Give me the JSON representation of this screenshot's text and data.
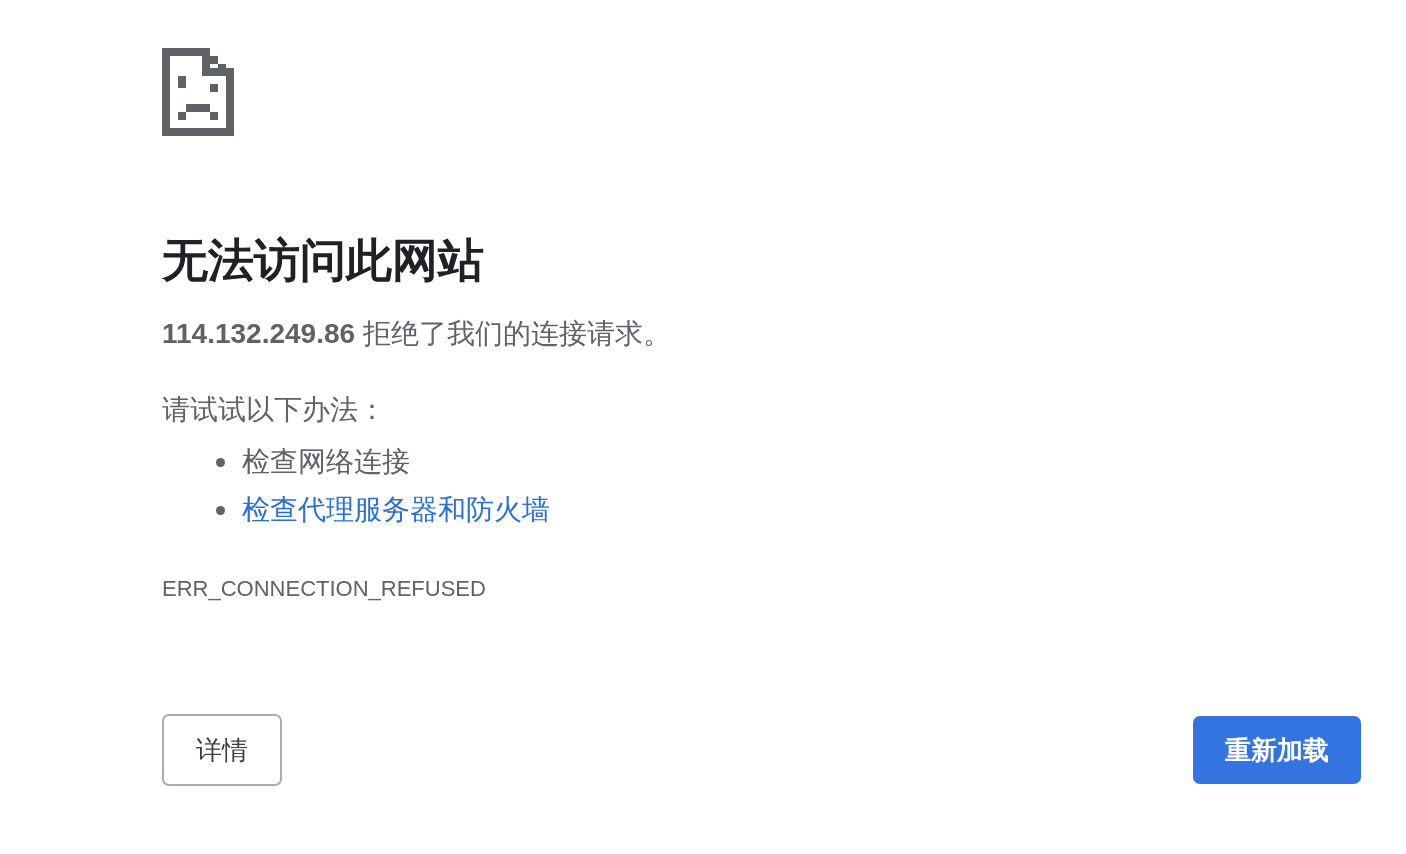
{
  "title": "无法访问此网站",
  "message": "**114.132.249.86** 拒绝了我们的连接请求。",
  "suggestions_heading": "请试试以下办法：",
  "suggestions": [
    {
      "text": "检查网络连接",
      "kind": "text"
    },
    {
      "text": "检查代理服务器和防火墙",
      "kind": "link"
    }
  ],
  "error_code": "ERR_CONNECTION_REFUSED",
  "buttons": [
    {
      "label": "详情",
      "kind": "secondary"
    },
    {
      "label": "重新加载",
      "kind": "primary"
    }
  ]
}
